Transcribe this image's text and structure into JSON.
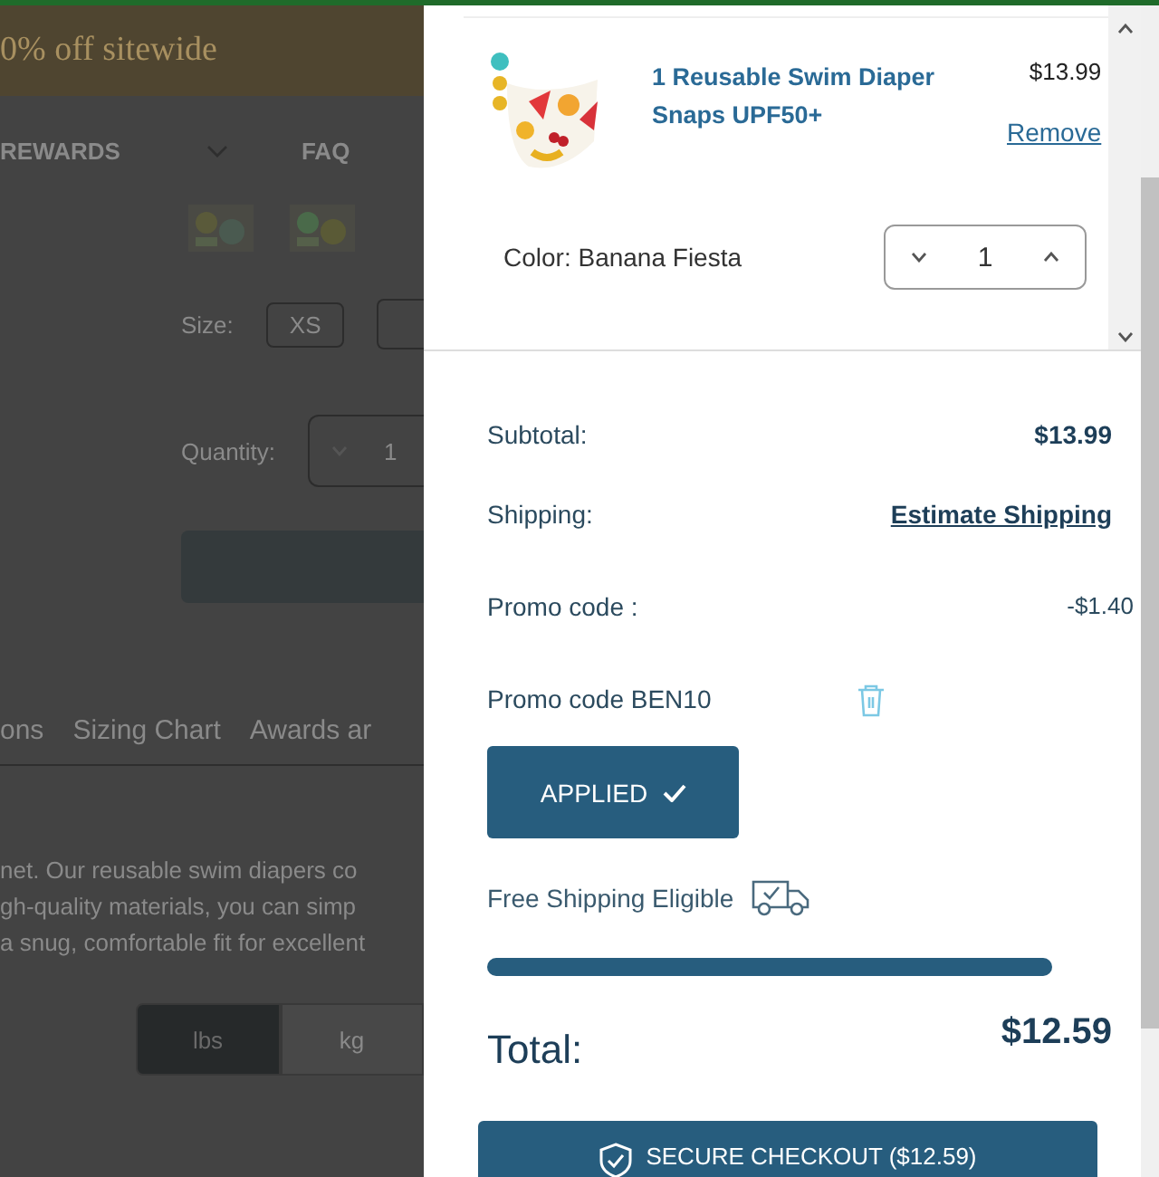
{
  "background_page": {
    "banner": "0% off sitewide",
    "nav": [
      {
        "label": "REWARDS",
        "kind": "dropdown"
      },
      {
        "label": "FAQ",
        "kind": "link"
      }
    ],
    "size": {
      "label": "Size:",
      "option": "XS"
    },
    "quantity": {
      "label": "Quantity:",
      "value": "1"
    },
    "tabs": [
      "ons",
      "Sizing Chart",
      "Awards ar"
    ],
    "description": [
      "net. Our reusable swim diapers co",
      "gh-quality materials, you can simp",
      "a snug, comfortable fit for excellent"
    ],
    "units": [
      {
        "label": "lbs",
        "selected": true
      },
      {
        "label": "kg",
        "selected": false
      }
    ]
  },
  "cart_item": {
    "title": "1 Reusable Swim Diaper Snaps UPF50+",
    "price": "$13.99",
    "remove": "Remove",
    "color_name": "Color: Banana Fiesta",
    "quantity": "1"
  },
  "summary": {
    "rows": [
      {
        "label": "Subtotal:",
        "value": "$13.99",
        "kind": "bold"
      },
      {
        "label": "Shipping:",
        "value": "Estimate Shipping",
        "kind": "link"
      },
      {
        "label": "Promo code :",
        "value": "-$1.40",
        "kind": "discount"
      }
    ],
    "promo": "Promo code BEN10",
    "apply_button": "APPLIED",
    "free_shipping": "Free Shipping Eligible",
    "progress": {
      "level": 1
    },
    "total_label": "Total:",
    "total": "$12.59",
    "checkout": "SECURE CHECKOUT ($12.59)"
  }
}
